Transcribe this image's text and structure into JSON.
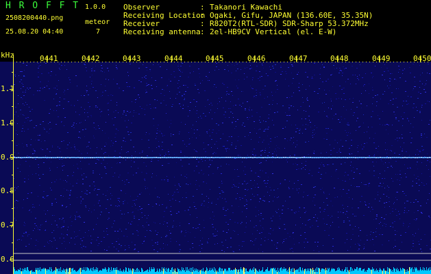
{
  "app": {
    "title_letters": "H R O F F T",
    "version": "1.0.0",
    "filename": "2508200440.png",
    "datetime": "25.08.20 04:40",
    "meteor_label": "meteor",
    "meteor_count": "7"
  },
  "info": {
    "rows": [
      {
        "label": "Observer",
        "sep": ":",
        "value": "Takanori Kawachi"
      },
      {
        "label": "Receiving Location",
        "sep": ":",
        "value": "Ogaki, Gifu, JAPAN (136.60E, 35.35N)"
      },
      {
        "label": "Receiver",
        "sep": ":",
        "value": "R820T2(RTL-SDR) SDR-Sharp 53.372MHz"
      },
      {
        "label": "Receiving antenna",
        "sep": ":",
        "value": "2el-HB9CV Vertical (el. E-W)"
      }
    ]
  },
  "spectrogram": {
    "y_unit": "kHz",
    "time_ticks": [
      "0441",
      "0442",
      "0443",
      "0444",
      "0445",
      "0446",
      "0447",
      "0448",
      "0449",
      "0450"
    ],
    "freq_ticks": [
      "1.1",
      "1.0",
      "0.9",
      "0.8",
      "0.7",
      "0.6"
    ],
    "freq_values": [
      1.1,
      1.0,
      0.9,
      0.8,
      0.7,
      0.6
    ],
    "carrier_khz": 0.9,
    "colors": {
      "background": "#000000",
      "noise_base": "#0a0a7a",
      "carrier": "#5aa8ff",
      "axis": "#ffff33",
      "guide_line": "#c8c8c8",
      "bottom_strip": "#00c8ff"
    }
  }
}
